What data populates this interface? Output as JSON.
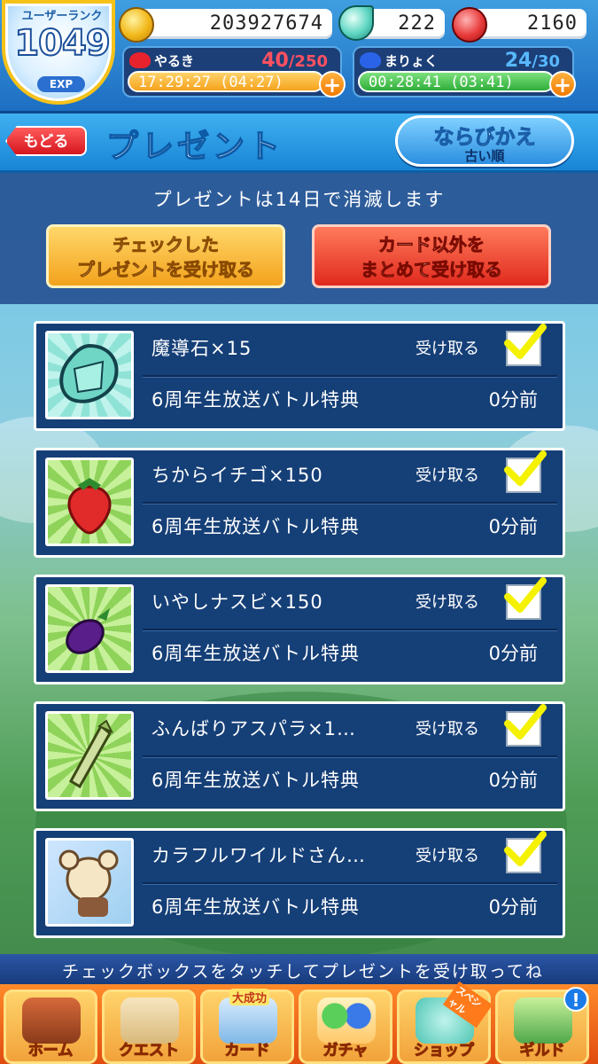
{
  "status": {
    "rank_title": "ユーザーランク",
    "rank_value": "1049",
    "rank_exp_label": "EXP",
    "coins": "203927674",
    "gems": "222",
    "tickets": "2160",
    "stamina": {
      "label": "やるき",
      "current": "40",
      "max": "/250",
      "timer": "17:29:27 (04:27)"
    },
    "mana": {
      "label": "まりょく",
      "current": "24",
      "max": "/30",
      "timer": "00:28:41 (03:41)"
    },
    "plus_label": "+"
  },
  "header": {
    "back_label": "もどる",
    "title": "プレゼント",
    "sort_label": "ならびかえ",
    "sort_value": "古い順"
  },
  "info": {
    "expiry_notice": "プレゼントは14日で消滅します",
    "receive_checked_line1": "チェックした",
    "receive_checked_line2": "プレゼントを受け取る",
    "receive_all_line1": "カード以外を",
    "receive_all_line2": "まとめて受け取る"
  },
  "presents": [
    {
      "name": "魔導石×15",
      "source": "6周年生放送バトル特典",
      "time": "0分前",
      "receive_label": "受け取る",
      "icon": "gem-icon",
      "checked": true
    },
    {
      "name": "ちからイチゴ×150",
      "source": "6周年生放送バトル特典",
      "time": "0分前",
      "receive_label": "受け取る",
      "icon": "strawberry-icon",
      "checked": true
    },
    {
      "name": "いやしナスビ×150",
      "source": "6周年生放送バトル特典",
      "time": "0分前",
      "receive_label": "受け取る",
      "icon": "eggplant-icon",
      "checked": true
    },
    {
      "name": "ふんばりアスパラ×1…",
      "source": "6周年生放送バトル特典",
      "time": "0分前",
      "receive_label": "受け取る",
      "icon": "asparagus-icon",
      "checked": true
    },
    {
      "name": "カラフルワイルドさん…",
      "source": "6周年生放送バトル特典",
      "time": "0分前",
      "receive_label": "受け取る",
      "icon": "card-character-icon",
      "checked": true
    }
  ],
  "ticker": "チェックボックスをタッチしてプレゼントを受け取ってね",
  "nav": [
    {
      "label": "ホーム",
      "icon": "home-icon"
    },
    {
      "label": "クエスト",
      "icon": "quest-map-icon"
    },
    {
      "label": "カード",
      "icon": "card-icon",
      "badge": "大成功"
    },
    {
      "label": "ガチャ",
      "icon": "gacha-icon"
    },
    {
      "label": "ショップ",
      "icon": "shop-icon",
      "badge": "スペシャル"
    },
    {
      "label": "ギルド",
      "icon": "guild-icon",
      "badge": "!"
    }
  ],
  "colors": {
    "accent_red": "#d6161f",
    "accent_orange": "#f5a21b",
    "list_bg": "#153f77",
    "check_yellow": "#f4f200"
  }
}
